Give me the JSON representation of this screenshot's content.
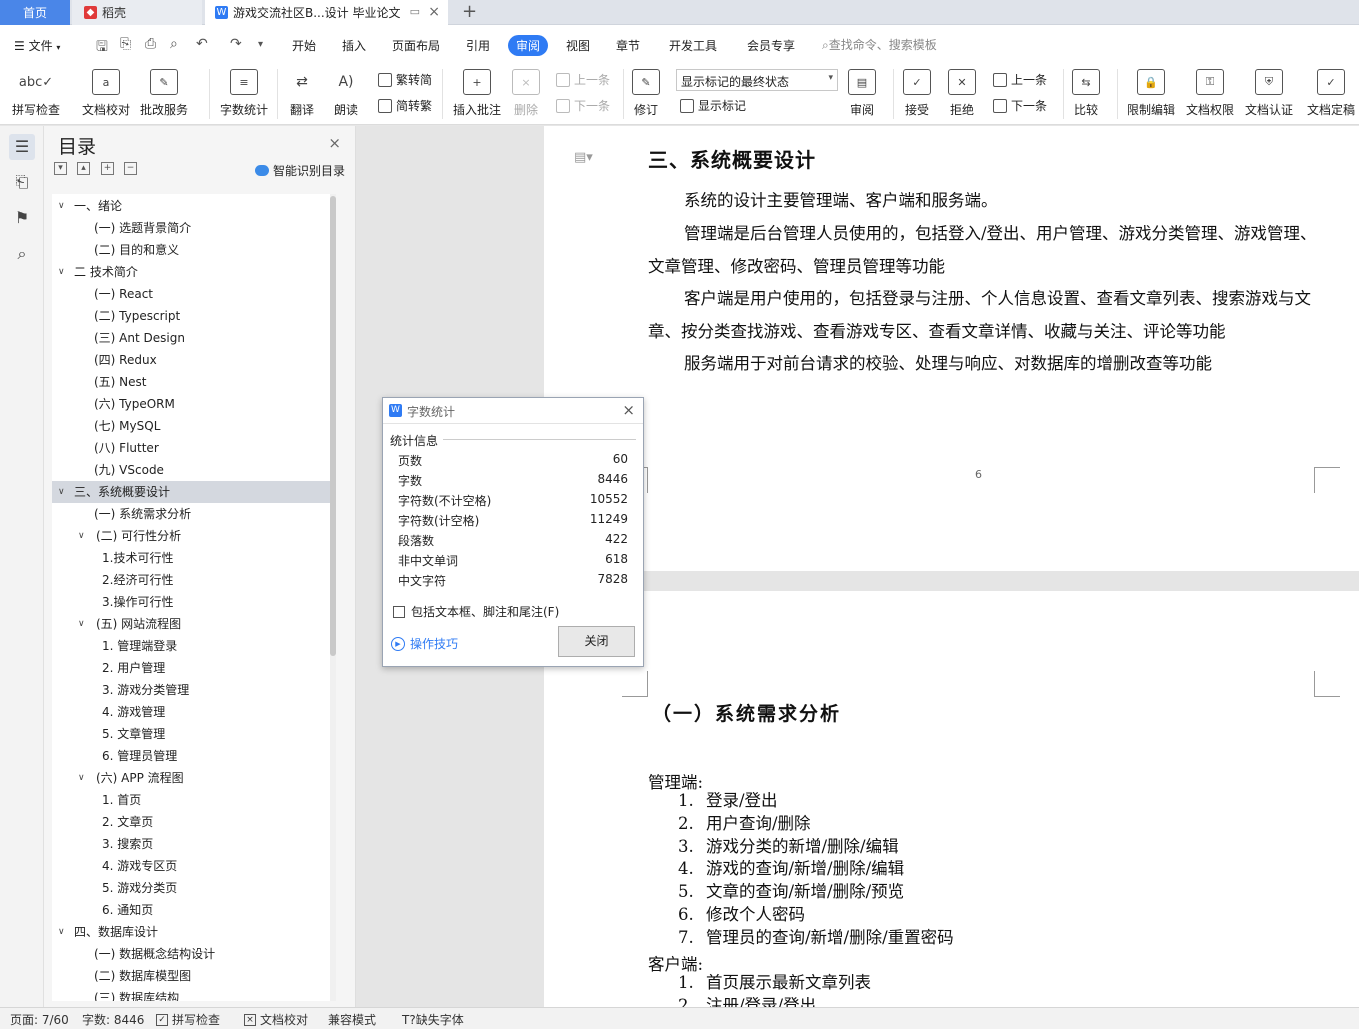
{
  "tabs": {
    "home": "首页",
    "daoke": "稻壳",
    "document": "游戏交流社区B...设计 毕业论文"
  },
  "menu": {
    "file": "文件",
    "items": [
      "开始",
      "插入",
      "页面布局",
      "引用",
      "审阅",
      "视图",
      "章节",
      "开发工具",
      "会员专享"
    ],
    "active": "审阅",
    "search_placeholder": "查找命令、搜索模板"
  },
  "ribbon": {
    "spell_check": "拼写检查",
    "doc_proofread": "文档校对",
    "batch_service": "批改服务",
    "word_count": "字数统计",
    "translate": "翻译",
    "read_aloud": "朗读",
    "trad_simp": "繁转简",
    "simp_trad": "简转繁",
    "insert_comment": "插入批注",
    "delete": "删除",
    "prev_comment": "上一条",
    "next_comment": "下一条",
    "revise": "修订",
    "markup_state": "显示标记的最终状态",
    "show_markup": "显示标记",
    "review": "审阅",
    "accept": "接受",
    "reject": "拒绝",
    "prev_change": "上一条",
    "next_change": "下一条",
    "compare": "比较",
    "restrict_edit": "限制编辑",
    "doc_permission": "文档权限",
    "doc_certify": "文档认证",
    "doc_finalize": "文档定稿"
  },
  "toc": {
    "title": "目录",
    "smart_button": "智能识别目录",
    "items": [
      {
        "text": "一、绪论",
        "indent": 1,
        "chevron": true
      },
      {
        "text": "(一) 选题背景简介",
        "indent": 2
      },
      {
        "text": "(二) 目的和意义",
        "indent": 2
      },
      {
        "text": "二 技术简介",
        "indent": 1,
        "chevron": true
      },
      {
        "text": "(一)   React",
        "indent": 2
      },
      {
        "text": "(二)   Typescript",
        "indent": 2
      },
      {
        "text": "(三) Ant Design",
        "indent": 2
      },
      {
        "text": "(四) Redux",
        "indent": 2
      },
      {
        "text": "(五) Nest",
        "indent": 2
      },
      {
        "text": "(六) TypeORM",
        "indent": 2
      },
      {
        "text": "(七) MySQL",
        "indent": 2
      },
      {
        "text": "(八) Flutter",
        "indent": 2
      },
      {
        "text": "(九) VScode",
        "indent": 2
      },
      {
        "text": "三、系统概要设计",
        "indent": 1,
        "chevron": true,
        "selected": true
      },
      {
        "text": "(一) 系统需求分析",
        "indent": 2
      },
      {
        "text": "(二) 可行性分析",
        "indent": 2,
        "chevron": true
      },
      {
        "text": "1.技术可行性",
        "indent": 3
      },
      {
        "text": "2.经济可行性",
        "indent": 3
      },
      {
        "text": "3.操作可行性",
        "indent": 3
      },
      {
        "text": "(五)   网站流程图",
        "indent": 2,
        "chevron": true
      },
      {
        "text": "1. 管理端登录",
        "indent": 3
      },
      {
        "text": "2. 用户管理",
        "indent": 3
      },
      {
        "text": "3. 游戏分类管理",
        "indent": 3
      },
      {
        "text": "4. 游戏管理",
        "indent": 3
      },
      {
        "text": "5. 文章管理",
        "indent": 3
      },
      {
        "text": "6. 管理员管理",
        "indent": 3
      },
      {
        "text": "(六)   APP 流程图",
        "indent": 2,
        "chevron": true
      },
      {
        "text": "1. 首页",
        "indent": 3
      },
      {
        "text": "2. 文章页",
        "indent": 3
      },
      {
        "text": "3. 搜索页",
        "indent": 3
      },
      {
        "text": "4. 游戏专区页",
        "indent": 3
      },
      {
        "text": "5. 游戏分类页",
        "indent": 3
      },
      {
        "text": "6. 通知页",
        "indent": 3
      },
      {
        "text": "四、数据库设计",
        "indent": 1,
        "chevron": true
      },
      {
        "text": "(一) 数据概念结构设计",
        "indent": 2
      },
      {
        "text": "(二) 数据库模型图",
        "indent": 2
      },
      {
        "text": "(三) 数据库结构",
        "indent": 2
      }
    ]
  },
  "document": {
    "heading": "三、系统概要设计",
    "paragraphs": [
      "系统的设计主要管理端、客户端和服务端。",
      "管理端是后台管理人员使用的，包括登入/登出、用户管理、游戏分类管理、游戏管理、文章管理、修改密码、管理员管理等功能",
      "客户端是用户使用的，包括登录与注册、个人信息设置、查看文章列表、搜索游戏与文章、按分类查找游戏、查看游戏专区、查看文章详情、收藏与关注、评论等功能",
      "服务端用于对前台请求的校验、处理与响应、对数据库的增删改查等功能"
    ],
    "page_number": "6",
    "section_title": "（一）系统需求分析",
    "admin_label": "管理端:",
    "admin_items": [
      {
        "num": "1.",
        "text": "登录/登出"
      },
      {
        "num": "2.",
        "text": "用户查询/删除"
      },
      {
        "num": "3.",
        "text": "游戏分类的新增/删除/编辑"
      },
      {
        "num": "4.",
        "text": "游戏的查询/新增/删除/编辑"
      },
      {
        "num": "5.",
        "text": "文章的查询/新增/删除/预览"
      },
      {
        "num": "6.",
        "text": "修改个人密码"
      },
      {
        "num": "7.",
        "text": "管理员的查询/新增/删除/重置密码"
      }
    ],
    "client_label": "客户端:",
    "client_items": [
      {
        "num": "1.",
        "text": "首页展示最新文章列表"
      },
      {
        "num": "2.",
        "text": "注册/登录/登出"
      }
    ]
  },
  "dialog": {
    "title": "字数统计",
    "section": "统计信息",
    "rows": [
      {
        "label": "页数",
        "value": "60"
      },
      {
        "label": "字数",
        "value": "8446"
      },
      {
        "label": "字符数(不计空格)",
        "value": "10552"
      },
      {
        "label": "字符数(计空格)",
        "value": "11249"
      },
      {
        "label": "段落数",
        "value": "422"
      },
      {
        "label": "非中文单词",
        "value": "618"
      },
      {
        "label": "中文字符",
        "value": "7828"
      }
    ],
    "checkbox_label": "包括文本框、脚注和尾注(F)",
    "tips_link": "操作技巧",
    "close_button": "关闭"
  },
  "status": {
    "page": "页面: 7/60",
    "words": "字数: 8446",
    "spell_check": "拼写检查",
    "doc_proofread": "文档校对",
    "compat_mode": "兼容模式",
    "missing_font": "缺失字体"
  }
}
